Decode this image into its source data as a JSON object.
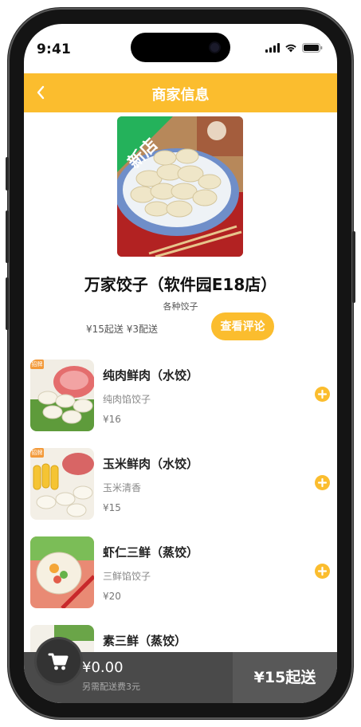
{
  "status_bar": {
    "time": "9:41"
  },
  "header": {
    "back_icon": "chevron-left-icon",
    "title": "商家信息"
  },
  "shop": {
    "name": "万家饺子（软件园E18店）",
    "category": "各种饺子",
    "fee_info": "¥15起送 ¥3配送",
    "new_tag": "新店",
    "review_button": "查看评论"
  },
  "products": [
    {
      "name": "纯肉鲜肉（水饺）",
      "desc": "纯肉馅饺子",
      "price": "¥16",
      "badge": "招牌"
    },
    {
      "name": "玉米鲜肉（水饺）",
      "desc": "玉米清香",
      "price": "¥15",
      "badge": "招牌"
    },
    {
      "name": "虾仁三鲜（蒸饺）",
      "desc": "三鲜馅饺子",
      "price": "¥20"
    },
    {
      "name": "素三鲜（蒸饺）"
    }
  ],
  "cart": {
    "icon": "shopping-cart-icon",
    "total": "¥0.00",
    "extra_fee": "另需配送费3元",
    "min_order": "¥15起送"
  },
  "colors": {
    "accent": "#fbbd2e",
    "cart_bar": "#4a4a4a"
  }
}
